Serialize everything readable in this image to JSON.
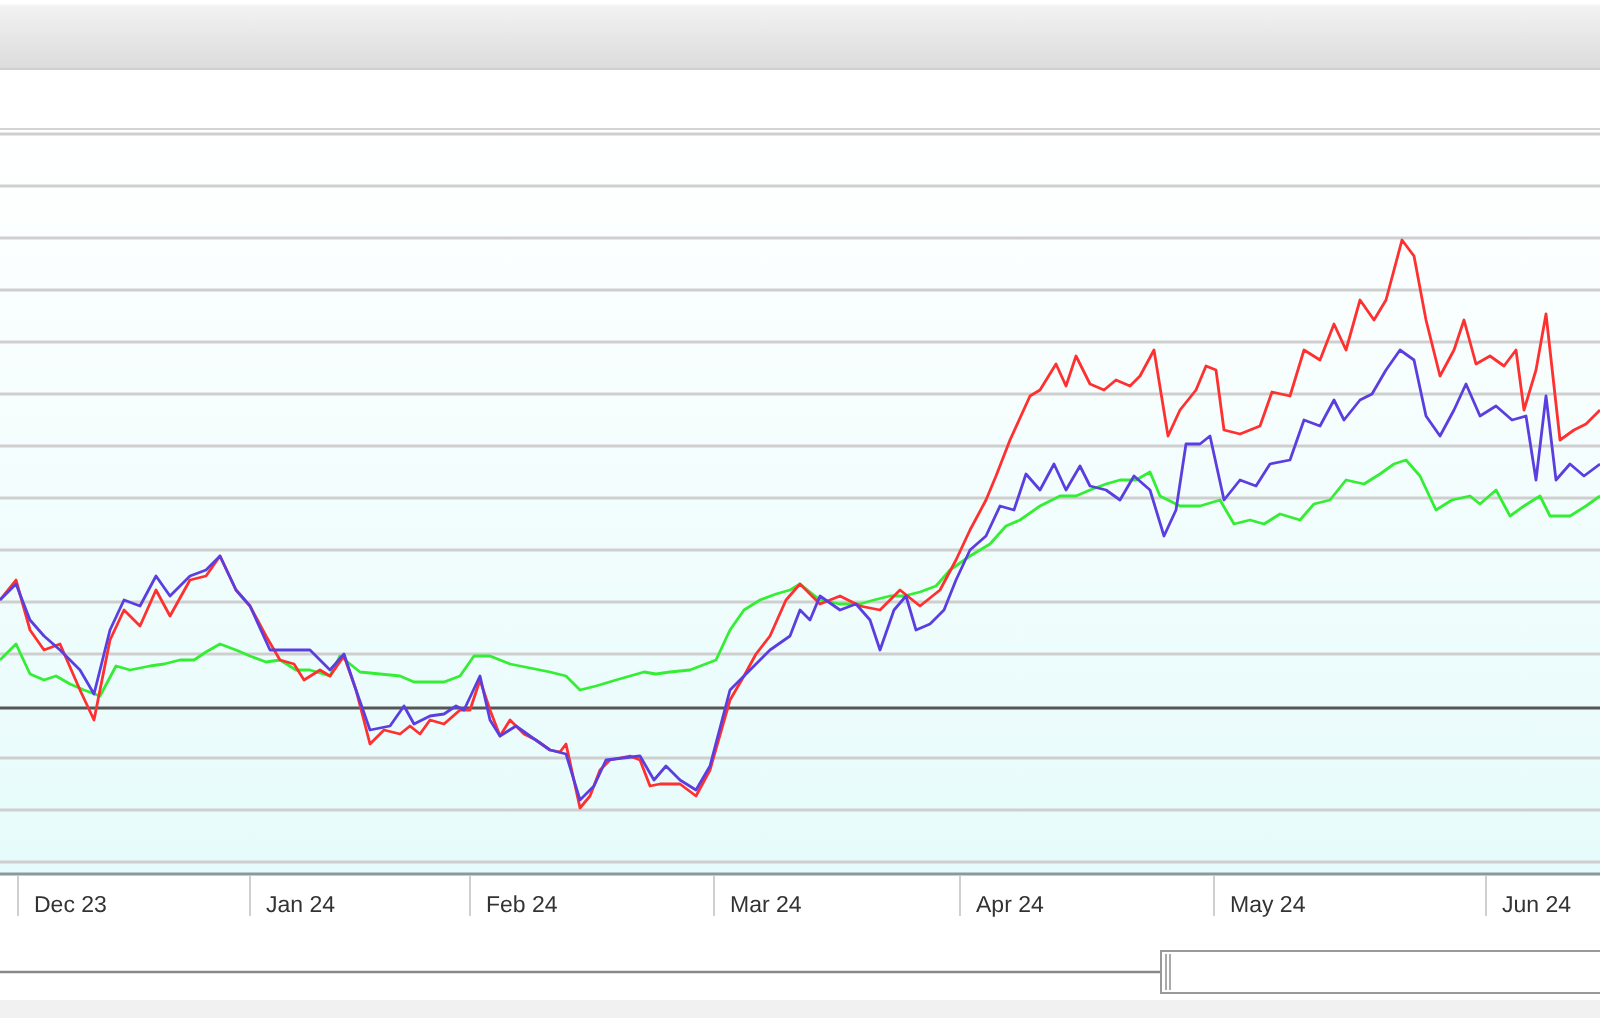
{
  "chart": {
    "x_labels": [
      "Dec 23",
      "Jan 24",
      "Feb 24",
      "Mar 24",
      "Apr 24",
      "May 24",
      "Jun 24"
    ]
  }
}
